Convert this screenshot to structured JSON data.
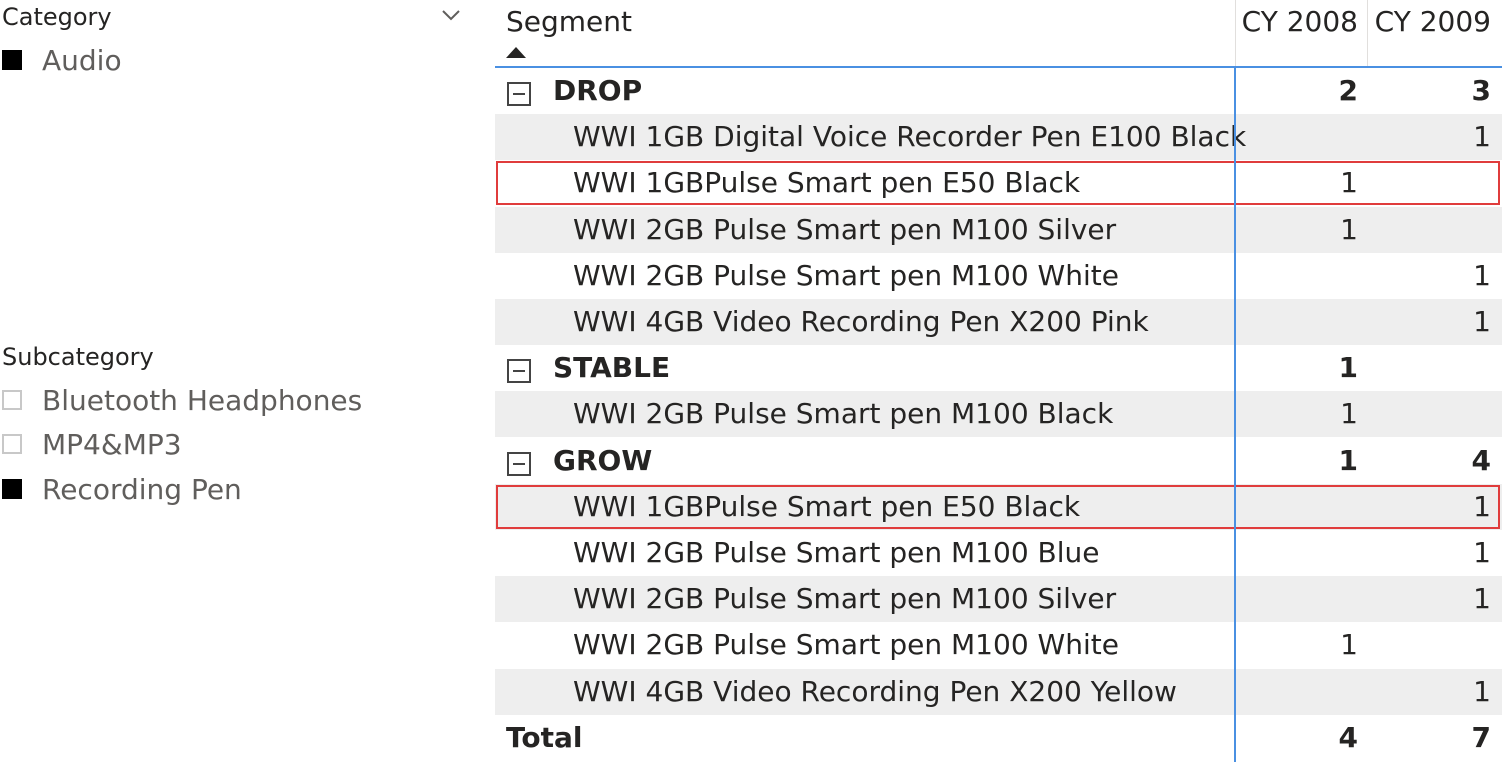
{
  "slicers": {
    "category": {
      "title": "Category",
      "items": [
        {
          "label": "Audio",
          "checked": true
        }
      ]
    },
    "subcategory": {
      "title": "Subcategory",
      "items": [
        {
          "label": "Bluetooth Headphones",
          "checked": false
        },
        {
          "label": "MP4&MP3",
          "checked": false
        },
        {
          "label": "Recording Pen",
          "checked": true
        }
      ]
    }
  },
  "matrix": {
    "columns": {
      "segment": "Segment",
      "cy2008": "CY 2008",
      "cy2009": "CY 2009"
    },
    "sort": {
      "column": "Segment",
      "direction": "ascending"
    },
    "rows": [
      {
        "type": "group",
        "label": "DROP",
        "cy2008": "2",
        "cy2009": "3"
      },
      {
        "type": "child",
        "label": "WWI 1GB Digital Voice Recorder Pen E100 Black",
        "cy2008": "",
        "cy2009": "1"
      },
      {
        "type": "child",
        "label": "WWI 1GBPulse Smart pen E50 Black",
        "cy2008": "1",
        "cy2009": "",
        "highlighted": true
      },
      {
        "type": "child",
        "label": "WWI 2GB Pulse Smart pen M100 Silver",
        "cy2008": "1",
        "cy2009": ""
      },
      {
        "type": "child",
        "label": "WWI 2GB Pulse Smart pen M100 White",
        "cy2008": "",
        "cy2009": "1"
      },
      {
        "type": "child",
        "label": "WWI 4GB Video Recording Pen X200 Pink",
        "cy2008": "",
        "cy2009": "1"
      },
      {
        "type": "group",
        "label": "STABLE",
        "cy2008": "1",
        "cy2009": ""
      },
      {
        "type": "child",
        "label": "WWI 2GB Pulse Smart pen M100 Black",
        "cy2008": "1",
        "cy2009": ""
      },
      {
        "type": "group",
        "label": "GROW",
        "cy2008": "1",
        "cy2009": "4"
      },
      {
        "type": "child",
        "label": "WWI 1GBPulse Smart pen E50 Black",
        "cy2008": "",
        "cy2009": "1",
        "highlighted": true
      },
      {
        "type": "child",
        "label": "WWI 2GB Pulse Smart pen M100 Blue",
        "cy2008": "",
        "cy2009": "1"
      },
      {
        "type": "child",
        "label": "WWI 2GB Pulse Smart pen M100 Silver",
        "cy2008": "",
        "cy2009": "1"
      },
      {
        "type": "child",
        "label": "WWI 2GB Pulse Smart pen M100 White",
        "cy2008": "1",
        "cy2009": ""
      },
      {
        "type": "child",
        "label": "WWI 4GB Video Recording Pen X200 Yellow",
        "cy2008": "",
        "cy2009": "1"
      }
    ],
    "total": {
      "label": "Total",
      "cy2008": "4",
      "cy2009": "7"
    }
  },
  "colors": {
    "accent_blue": "#4a90e2",
    "highlight_red": "#e03c3c",
    "row_shade": "#eeeeee",
    "checked": "#000000",
    "unchecked_border": "#c8c8c8"
  },
  "icons": [
    "chevron-down-icon",
    "sort-ascending-icon",
    "collapse-minus-icon",
    "checkbox-icon"
  ]
}
